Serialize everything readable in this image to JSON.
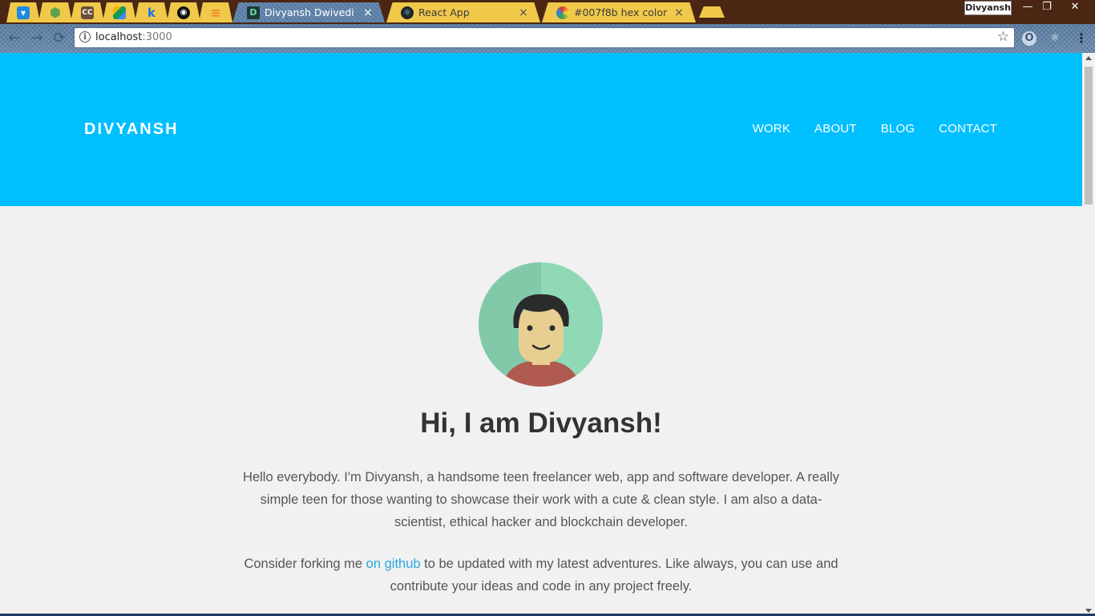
{
  "browser": {
    "pinned_tabs": [
      {
        "icon": "bird-icon",
        "glyph": "🐦",
        "color": "#1e88e5"
      },
      {
        "icon": "node-hexagon-icon",
        "glyph": "⬢",
        "color": "#5fa04e"
      },
      {
        "icon": "cc-icon",
        "glyph": "CC",
        "color": "#6b4f3a"
      },
      {
        "icon": "drive-icon",
        "glyph": "▲",
        "color": "#2e9d5a"
      },
      {
        "icon": "k-icon",
        "glyph": "k",
        "color": "#1a73e8"
      },
      {
        "icon": "github-icon",
        "glyph": "●",
        "color": "#111111"
      },
      {
        "icon": "stack-icon",
        "glyph": "≡",
        "color": "#f48024"
      }
    ],
    "tabs": [
      {
        "title": "Divyansh Dwivedi",
        "icon": "d-favicon-icon",
        "glyph": "D",
        "active": true
      },
      {
        "title": "React App",
        "icon": "react-icon",
        "glyph": "⚛",
        "active": false
      },
      {
        "title": "#007f8b hex color",
        "icon": "color-hex-icon",
        "glyph": "⬡",
        "active": false
      }
    ],
    "tab_close_glyph": "×",
    "profile_name": "Divyansh",
    "window_controls": {
      "minimize": "—",
      "maximize": "❐",
      "close": "✕"
    },
    "nav_icons": {
      "back": "←",
      "forward": "→",
      "reload": "⟳"
    },
    "url_host": "localhost",
    "url_port": ":3000",
    "bookmark_glyph": "☆",
    "extensions": [
      {
        "icon": "opera-icon",
        "glyph": "O"
      },
      {
        "icon": "react-devtools-icon",
        "glyph": "⚛"
      },
      {
        "icon": "menu-icon",
        "glyph": "⋮"
      }
    ]
  },
  "site": {
    "brand": "DIVYANSH",
    "nav": [
      "WORK",
      "ABOUT",
      "BLOG",
      "CONTACT"
    ],
    "hero_title": "Hi, I am Divyansh!",
    "intro": "Hello everybody. I'm Divyansh, a handsome teen freelancer web, app and software developer. A really simple teen for those wanting to showcase their work with a cute & clean style. I am also a data-scientist, ethical hacker and blockchain developer.",
    "fork_before": "Consider forking me ",
    "fork_link": "on github",
    "fork_after": " to be updated with my latest adventures. Like always, you can use and contribute your ideas and code in any project freely.",
    "colors": {
      "header": "#00bfff",
      "link": "#29a8e0",
      "avatar_bg": "#8fd9b6"
    }
  }
}
